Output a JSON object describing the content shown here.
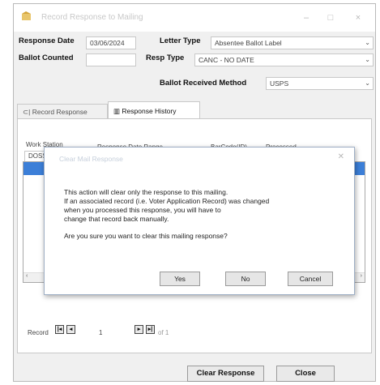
{
  "window": {
    "title": "Record Response to Mailing",
    "controls": {
      "minimize": "–",
      "maximize": "□",
      "close": "×"
    }
  },
  "form": {
    "response_date_label": "Response Date",
    "response_date_value": "03/06/2024",
    "letter_type_label": "Letter Type",
    "letter_type_value": "Absentee Ballot Label",
    "ballot_counted_label": "Ballot Counted",
    "ballot_counted_value": "",
    "resp_type_label": "Resp Type",
    "resp_type_value": "CANC - NO DATE",
    "ballot_received_method_label": "Ballot Received Method",
    "ballot_received_method_value": "USPS"
  },
  "tabs": [
    {
      "label": "Record Response",
      "icon": "record-icon"
    },
    {
      "label": "Response History",
      "icon": "history-icon"
    }
  ],
  "history": {
    "columns": [
      "Work Station",
      "Response Date Range",
      "BarCode(ID)",
      "Processed"
    ],
    "first_cell": "DOSS",
    "navigator": {
      "record_label": "Record",
      "current": "1",
      "of_text": "of 1"
    }
  },
  "dialog": {
    "title": "Clear Mail Response",
    "message_lines": [
      "This action will clear only the response to this mailing.",
      "If an associated record (i.e. Voter Application Record) was changed",
      "when you processed this response, you will have to",
      "change that record back manually."
    ],
    "question": "Are you sure you want to clear this mailing response?",
    "buttons": {
      "yes": "Yes",
      "no": "No",
      "cancel": "Cancel"
    }
  },
  "bottom_buttons": {
    "clear_response": "Clear Response",
    "close": "Close"
  }
}
